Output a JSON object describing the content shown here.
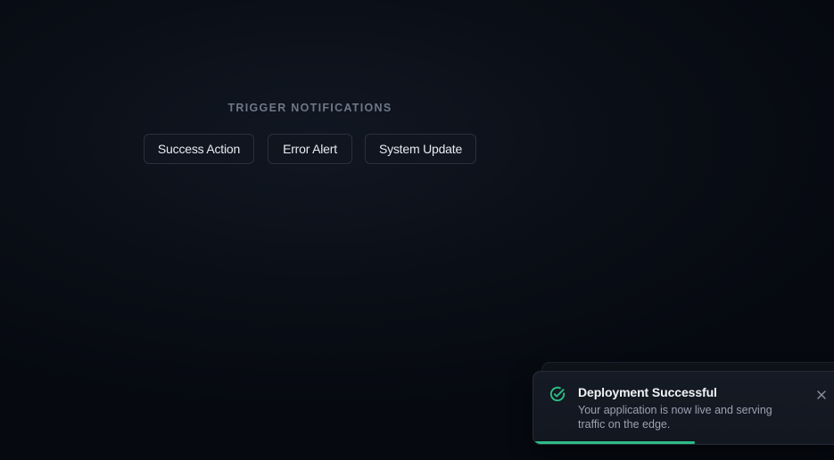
{
  "section": {
    "title": "TRIGGER NOTIFICATIONS"
  },
  "buttons": {
    "success": "Success Action",
    "error": "Error Alert",
    "update": "System Update"
  },
  "toast": {
    "title": "Deployment Successful",
    "message": "Your application is now live and serving traffic on the edge.",
    "icon": "check-circle-icon",
    "close_icon": "close-icon",
    "progress_percent": 52,
    "accent_color": "#2ebd85"
  }
}
